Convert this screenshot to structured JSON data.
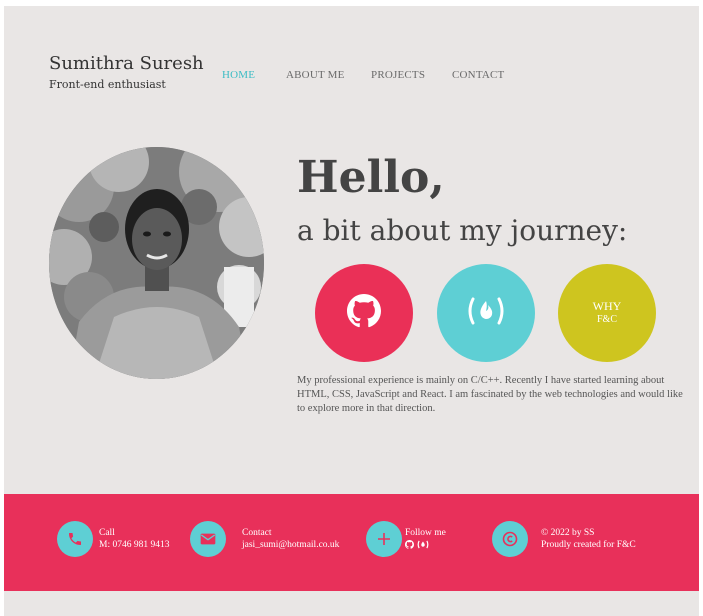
{
  "header": {
    "name": "Sumithra Suresh",
    "tagline": "Front-end enthusiast"
  },
  "nav": [
    {
      "label": "HOME",
      "active": true
    },
    {
      "label": "ABOUT ME",
      "active": false
    },
    {
      "label": "PROJECTS",
      "active": false
    },
    {
      "label": "CONTACT",
      "active": false
    }
  ],
  "hero": {
    "greeting": "Hello,",
    "subtitle": "a bit about my journey:",
    "buttons": [
      {
        "icon": "github-icon",
        "color": "#ea3057"
      },
      {
        "icon": "freecodecamp-icon",
        "color": "#5ecfd4"
      },
      {
        "line1": "WHY",
        "line2": "F&C",
        "color": "#cec51f"
      }
    ],
    "bio": "My professional experience is mainly on C/C++. Recently I have started learning about HTML, CSS, JavaScript and React. I am fascinated by the web technologies and would like to explore more in that direction."
  },
  "footer": {
    "call": {
      "icon": "phone-icon",
      "title": "Call",
      "value": "M: 0746 981 9413"
    },
    "contact": {
      "icon": "envelope-icon",
      "title": "Contact",
      "value": "jasi_sumi@hotmail.co.uk"
    },
    "follow": {
      "icon": "plus-icon",
      "title": "Follow me"
    },
    "copyright": {
      "icon": "copyright-icon",
      "line1": "© 2022 by SS",
      "line2": "Proudly created for F&C"
    }
  },
  "colors": {
    "accent_red": "#e8305a",
    "accent_teal": "#5ecfd4",
    "accent_yellow": "#cec51f",
    "background": "#e9e6e5"
  }
}
